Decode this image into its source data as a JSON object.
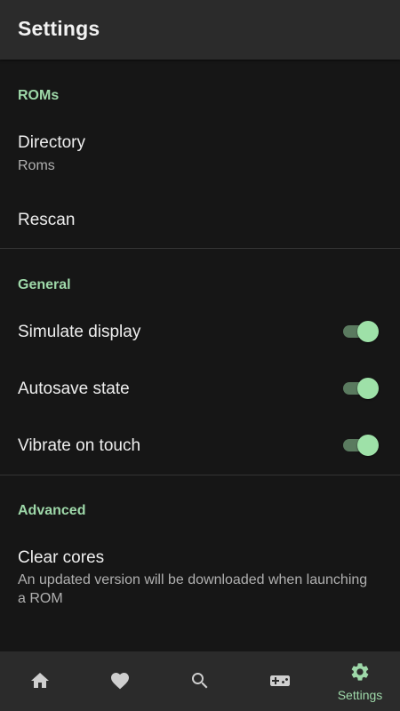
{
  "app_bar": {
    "title": "Settings"
  },
  "sections": {
    "roms": {
      "header": "ROMs",
      "directory": {
        "title": "Directory",
        "value": "Roms"
      },
      "rescan": {
        "title": "Rescan"
      }
    },
    "general": {
      "header": "General",
      "simulate_display": {
        "title": "Simulate display",
        "enabled": true
      },
      "autosave_state": {
        "title": "Autosave state",
        "enabled": true
      },
      "vibrate_on_touch": {
        "title": "Vibrate on touch",
        "enabled": true
      }
    },
    "advanced": {
      "header": "Advanced",
      "clear_cores": {
        "title": "Clear cores",
        "summary": "An updated version will be downloaded when launching a ROM"
      }
    }
  },
  "bottom_nav": {
    "items": [
      {
        "icon": "home-icon",
        "label": ""
      },
      {
        "icon": "heart-icon",
        "label": ""
      },
      {
        "icon": "search-icon",
        "label": ""
      },
      {
        "icon": "gamepad-icon",
        "label": ""
      },
      {
        "icon": "gear-icon",
        "label": "Settings",
        "active": true
      }
    ]
  },
  "colors": {
    "accent": "#9ed8a9",
    "background": "#161616",
    "bar": "#2b2b2b",
    "icon_inactive": "#cfcfcf"
  }
}
